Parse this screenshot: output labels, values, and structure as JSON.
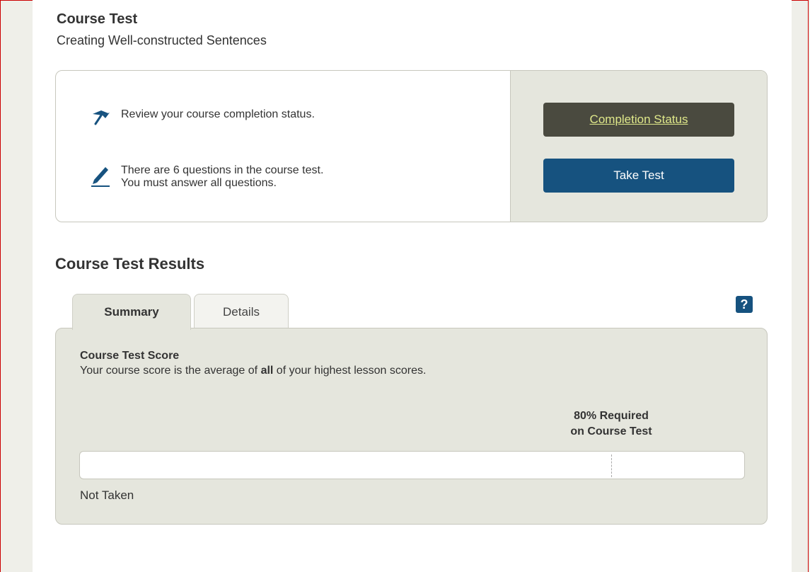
{
  "header": {
    "title": "Course Test",
    "subtitle": "Creating Well-constructed Sentences"
  },
  "info_panel": {
    "status_row": {
      "icon": "flag-icon",
      "text": "Review your course completion status."
    },
    "test_row": {
      "icon": "pencil-icon",
      "line1": "There are 6 questions in the course test.",
      "line2": "You must answer all questions."
    },
    "completion_button": "Completion Status",
    "take_test_button": "Take Test"
  },
  "results": {
    "title": "Course Test Results",
    "tabs": [
      {
        "label": "Summary",
        "active": true
      },
      {
        "label": "Details",
        "active": false
      }
    ],
    "help_label": "?",
    "score_title": "Course Test Score",
    "score_desc_before": "Your course score is the average of ",
    "score_desc_bold": "all",
    "score_desc_after": " of your highest lesson scores.",
    "required_line1": "80% Required",
    "required_line2": "on Course Test",
    "required_percent": 80,
    "score_percent": 0,
    "status": "Not Taken"
  },
  "colors": {
    "primary": "#16527f",
    "dark_button": "#4a4a3f",
    "link_on_dark": "#dfe88a",
    "panel_bg": "#e5e6dd"
  }
}
